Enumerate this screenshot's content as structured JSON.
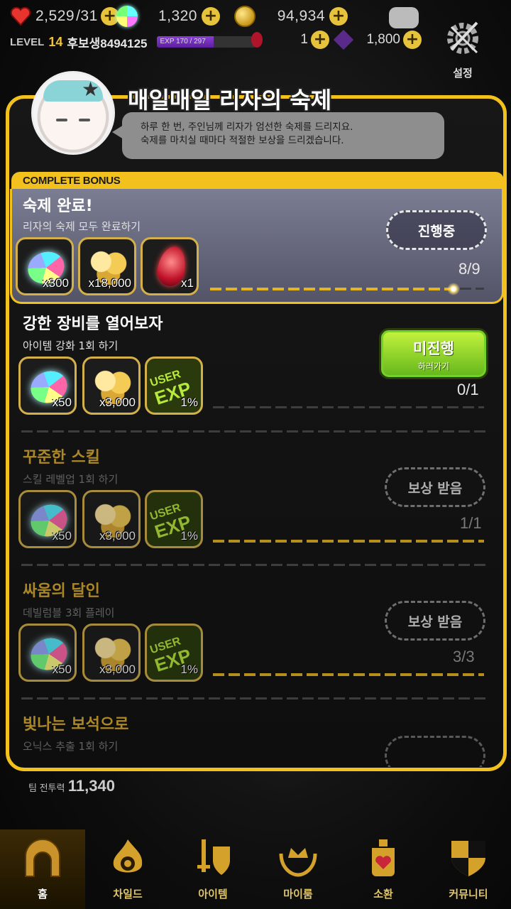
{
  "status_bar": {
    "hearts": "2,529",
    "hearts_max": "/31",
    "gems": "1,320",
    "gold": "94,934",
    "level_label": "LEVEL",
    "level": "14",
    "player_name": "후보생8494125",
    "exp_label": "EXP 170 / 297",
    "exp_progress": 0.57,
    "ruby": "1",
    "dark_crystal": "1,800"
  },
  "side": {
    "settings_label": "설정"
  },
  "panel": {
    "title": "매일매일 리자의 숙제",
    "bubble_line1": "하루 한 번, 주인님께 리자가 엄선한 숙제를 드리지요.",
    "bubble_line2": "숙제를 마치실 때마다 적절한 보상을 드리겠습니다.",
    "complete_bonus_label": "COMPLETE BONUS"
  },
  "quests": [
    {
      "title": "숙제 완료!",
      "desc": "리자의 숙제 모두 완료하기",
      "button": "진행중",
      "counter": "8/9",
      "progress": 0.889,
      "rewards": [
        {
          "icon": "rainbow-gem-icon",
          "qty": "x300"
        },
        {
          "icon": "gold-coins-icon",
          "qty": "x18,000"
        },
        {
          "icon": "ruby-icon",
          "qty": "x1"
        }
      ]
    },
    {
      "title": "강한 장비를 열어보자",
      "desc": "아이템 강화 1회 하기",
      "button": "미진행",
      "button_sub": "하러가기",
      "counter": "0/1",
      "progress": 0,
      "rewards": [
        {
          "icon": "rainbow-gem-icon",
          "qty": "x50"
        },
        {
          "icon": "gold-coins-icon",
          "qty": "x3,000"
        },
        {
          "icon": "user-exp-icon",
          "qty": "1%",
          "label_a": "USER",
          "label_b": "EXP"
        }
      ]
    },
    {
      "title": "꾸준한 스킬",
      "desc": "스킬 레벨업 1회 하기",
      "button": "보상 받음",
      "counter": "1/1",
      "progress": 1,
      "rewards": [
        {
          "icon": "rainbow-gem-icon",
          "qty": "x50"
        },
        {
          "icon": "gold-coins-icon",
          "qty": "x3,000"
        },
        {
          "icon": "user-exp-icon",
          "qty": "1%",
          "label_a": "USER",
          "label_b": "EXP"
        }
      ]
    },
    {
      "title": "싸움의 달인",
      "desc": "데빌럼블 3회 플레이",
      "button": "보상 받음",
      "counter": "3/3",
      "progress": 1,
      "rewards": [
        {
          "icon": "rainbow-gem-icon",
          "qty": "x50"
        },
        {
          "icon": "gold-coins-icon",
          "qty": "x3,000"
        },
        {
          "icon": "user-exp-icon",
          "qty": "1%",
          "label_a": "USER",
          "label_b": "EXP"
        }
      ]
    },
    {
      "title": "빛나는 보석으로",
      "desc": "오닉스 추출 1회 하기"
    }
  ],
  "team_power": {
    "label": "팀 전투력",
    "value": "11,340"
  },
  "nav": [
    "홈",
    "차일드",
    "아이템",
    "마이룸",
    "소환",
    "커뮤니티"
  ],
  "colors": {
    "accent": "#f2c11d",
    "go_button": "#8fd52c",
    "exp_bar": "#7a35c4"
  }
}
